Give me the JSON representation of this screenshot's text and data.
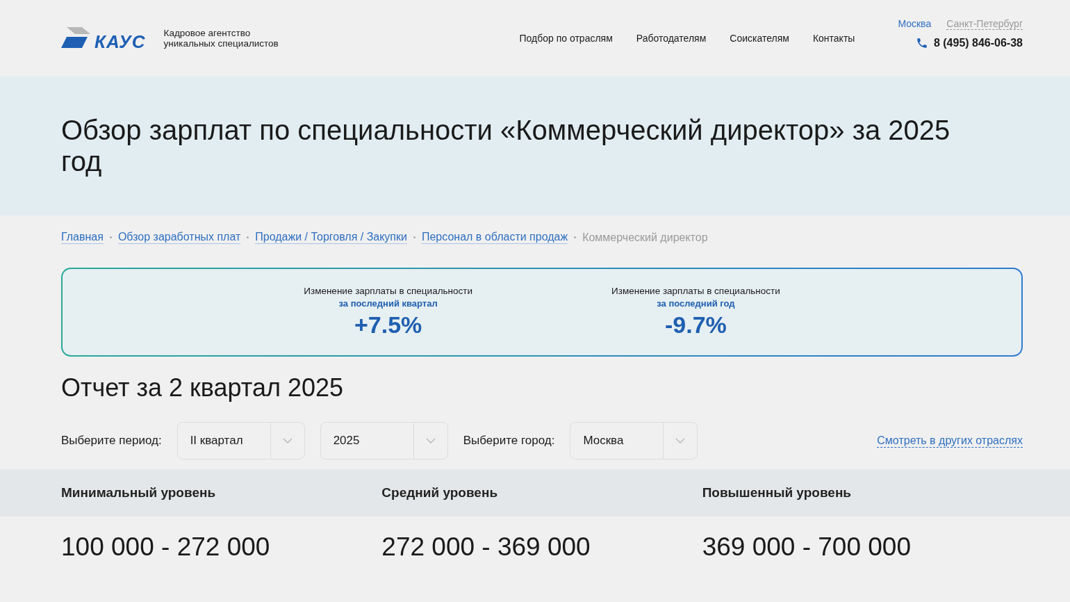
{
  "header": {
    "logo": "КАУС",
    "tagline_lines": [
      "Кадровое агентство",
      "уникальных специалистов"
    ],
    "nav": [
      "Подбор по отраслям",
      "Работодателям",
      "Соискателям",
      "Контакты"
    ],
    "cities": [
      {
        "label": "Москва",
        "selected": true
      },
      {
        "label": "Санкт-Петербург",
        "selected": false
      }
    ],
    "phone": "8 (495) 846-06-38"
  },
  "title": "Обзор зарплат по специальности «Коммерческий директор» за 2025 год",
  "breadcrumbs": [
    {
      "label": "Главная",
      "kind": "link"
    },
    {
      "label": "Обзор заработных плат",
      "kind": "link"
    },
    {
      "label": "Продажи / Торговля / Закупки",
      "kind": "link"
    },
    {
      "label": "Персонал в области продаж",
      "kind": "link"
    },
    {
      "label": "Коммерческий директор",
      "kind": "current"
    }
  ],
  "changes": [
    {
      "label": "Изменение зарплаты в специальности",
      "period": "за последний квартал",
      "value": "+7.5%"
    },
    {
      "label": "Изменение зарплаты в специальности",
      "period": "за последний год",
      "value": "-9.7%"
    }
  ],
  "report_title": "Отчет за 2 квартал 2025",
  "filters": {
    "period_label": "Выберите период:",
    "quarter": "II квартал",
    "year": "2025",
    "city_label": "Выберите город:",
    "city": "Москва",
    "other_link": "Смотреть в других отраслях"
  },
  "levels": [
    {
      "name": "Минимальный уровень",
      "range": "100 000 - 272 000"
    },
    {
      "name": "Средний уровень",
      "range": "272 000 - 369 000"
    },
    {
      "name": "Повышенный уровень",
      "range": "369 000 - 700 000"
    }
  ]
}
